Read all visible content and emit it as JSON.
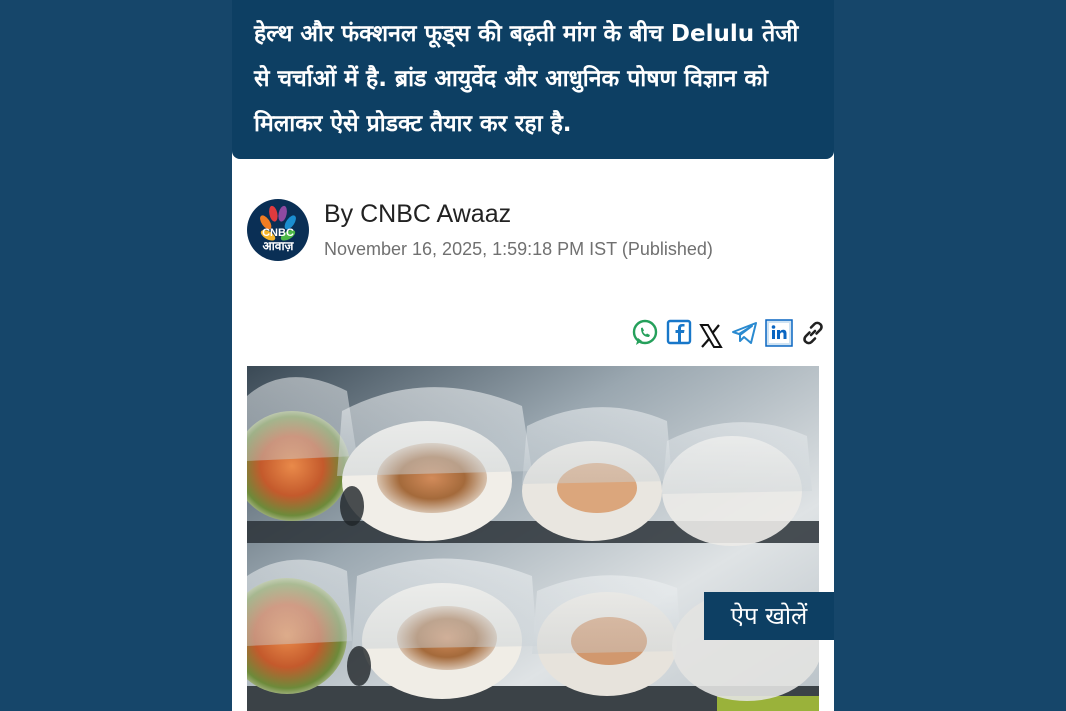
{
  "summary": {
    "text": "हेल्थ और फंक्शनल फूड्स की बढ़ती मांग के बीच Delulu तेजी से चर्चाओं में है. ब्रांड आयुर्वेद और आधुनिक पोषण विज्ञान को मिलाकर ऐसे प्रोडक्ट तैयार कर रहा है."
  },
  "byline": {
    "logo_line1": "CNBC",
    "logo_line2": "आवाज़",
    "author": "By CNBC Awaaz",
    "date": "November 16, 2025, 1:59:18 PM IST (Published)"
  },
  "share": {
    "icons": [
      "whatsapp-icon",
      "facebook-icon",
      "x-icon",
      "telegram-icon",
      "linkedin-icon",
      "link-icon"
    ],
    "colors": {
      "whatsapp": "#25a05b",
      "facebook": "#1877c9",
      "x": "#111111",
      "telegram": "#2a8ad0",
      "linkedin": "#0a66c2",
      "link": "#222222"
    }
  },
  "floating": {
    "open_app_label": "ऐप खोलें"
  },
  "colors": {
    "background": "#16466a",
    "summary_bg": "#0d3f63"
  }
}
